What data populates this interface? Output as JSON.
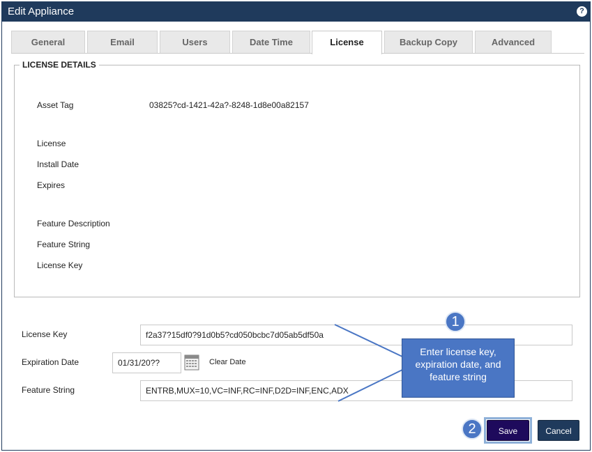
{
  "window": {
    "title": "Edit Appliance",
    "help_glyph": "?"
  },
  "tabs": [
    {
      "label": "General"
    },
    {
      "label": "Email"
    },
    {
      "label": "Users"
    },
    {
      "label": "Date Time"
    },
    {
      "label": "License",
      "active": true
    },
    {
      "label": "Backup Copy"
    },
    {
      "label": "Advanced"
    }
  ],
  "details": {
    "legend": "LICENSE DETAILS",
    "asset_tag_label": "Asset Tag",
    "asset_tag_value": "03825?cd-1421-42a?-8248-1d8e00a82157",
    "license_label": "License",
    "install_date_label": "Install Date",
    "expires_label": "Expires",
    "feature_description_label": "Feature Description",
    "feature_string_label": "Feature String",
    "license_key_label": "License Key"
  },
  "form": {
    "license_key_label": "License Key",
    "license_key_value": "f2a37?15df0?91d0b5?cd050bcbc7d05ab5df50a",
    "expiration_date_label": "Expiration Date",
    "expiration_date_value": "01/31/20??",
    "clear_date_label": "Clear Date",
    "feature_string_label": "Feature String",
    "feature_string_value": "ENTRB,MUX=10,VC=INF,RC=INF,D2D=INF,ENC,ADX"
  },
  "buttons": {
    "save_label": "Save",
    "cancel_label": "Cancel"
  },
  "annotations": {
    "step1_number": "1",
    "step1_text": "Enter license key, expiration date, and feature string",
    "step2_number": "2"
  },
  "colors": {
    "titlebar": "#1f3a5c",
    "save_button": "#1e0a5c",
    "cancel_button": "#1f3a5c",
    "callout": "#4a76c4"
  }
}
